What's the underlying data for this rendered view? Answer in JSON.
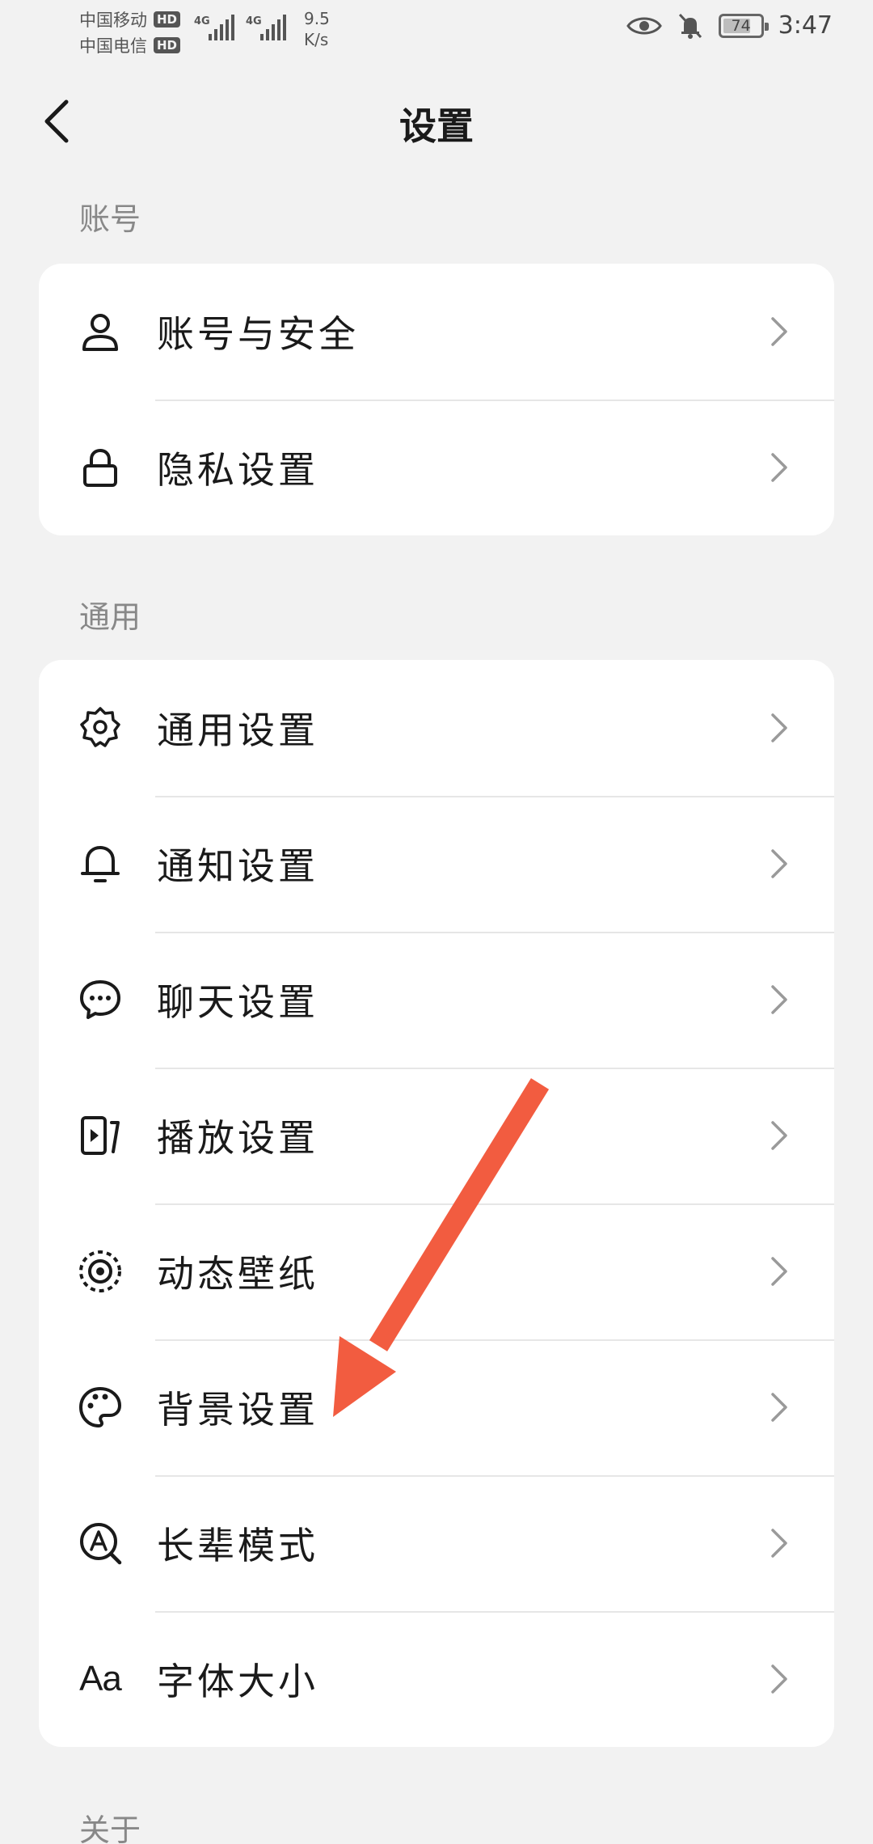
{
  "status_bar": {
    "carrier1": "中国移动",
    "carrier2": "中国电信",
    "hd": "HD",
    "network": "4G",
    "speed_value": "9.5",
    "speed_unit": "K/s",
    "battery": "74",
    "battery_level": 0.74,
    "time": "3:47"
  },
  "header": {
    "title": "设置"
  },
  "sections": {
    "account": {
      "label": "账号",
      "items": [
        {
          "label": "账号与安全",
          "icon": "user-icon"
        },
        {
          "label": "隐私设置",
          "icon": "lock-icon"
        }
      ]
    },
    "general": {
      "label": "通用",
      "items": [
        {
          "label": "通用设置",
          "icon": "gear-icon"
        },
        {
          "label": "通知设置",
          "icon": "bell-icon"
        },
        {
          "label": "聊天设置",
          "icon": "chat-bubble-icon"
        },
        {
          "label": "播放设置",
          "icon": "play-icon"
        },
        {
          "label": "动态壁纸",
          "icon": "live-wallpaper-icon"
        },
        {
          "label": "背景设置",
          "icon": "palette-icon"
        },
        {
          "label": "长辈模式",
          "icon": "elder-mode-icon"
        },
        {
          "label": "字体大小",
          "icon": "font-size-icon",
          "glyph": "Aa"
        }
      ]
    },
    "about": {
      "label": "关于"
    }
  },
  "colors": {
    "background": "#f2f2f2",
    "card": "#ffffff",
    "annotation_arrow": "#f25c40"
  }
}
